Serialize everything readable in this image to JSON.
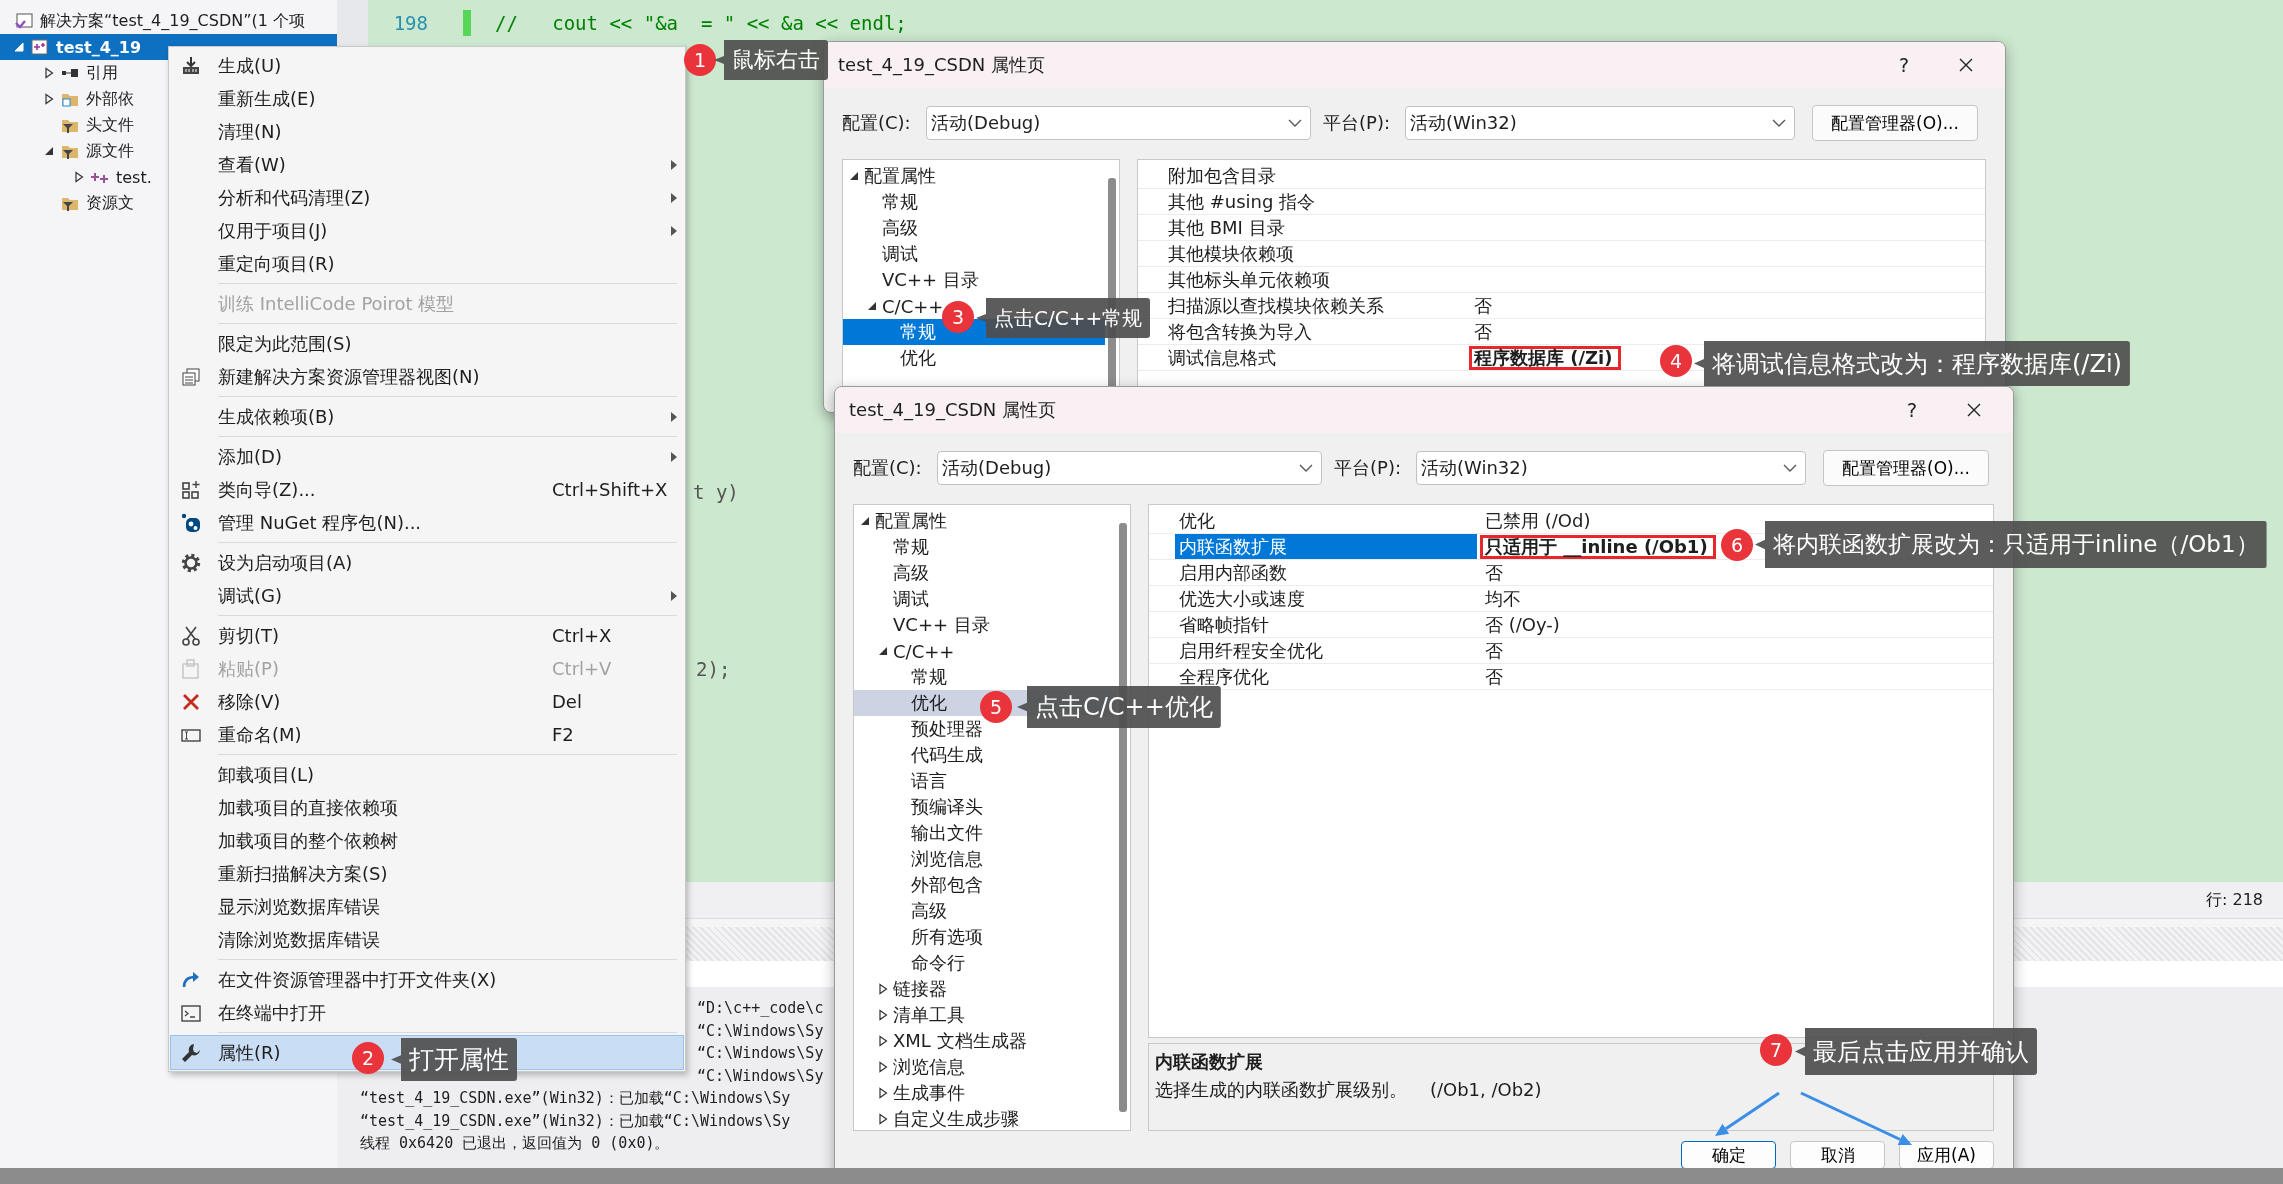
{
  "solution_explorer": {
    "title": "解决方案“test_4_19_CSDN”(1 个项",
    "tree": [
      {
        "label": "test_4_19",
        "kind": "project",
        "expanded": true,
        "selected": true,
        "children": [
          {
            "label": "引用",
            "kind": "references",
            "expanded": false,
            "selected": false
          },
          {
            "label": "外部依",
            "kind": "external",
            "expanded": false,
            "selected": false
          },
          {
            "label": "头文件",
            "kind": "filter",
            "selected": false
          },
          {
            "label": "源文件",
            "kind": "filter",
            "expanded": true,
            "selected": false,
            "children": [
              {
                "label": "test.",
                "kind": "cpp",
                "expanded": false,
                "selected": false
              }
            ]
          },
          {
            "label": "资源文",
            "kind": "filter",
            "selected": false
          }
        ]
      }
    ]
  },
  "editor": {
    "lines": [
      {
        "number": "198",
        "text": "//   cout << \"&a  = \" << &a << endl;"
      }
    ],
    "fragments": [
      "t y)",
      "2);"
    ]
  },
  "context_menu": {
    "groups": [
      [
        {
          "label": "生成(U)",
          "kind": "build",
          "submenu": false,
          "disabled": false,
          "selected": false
        },
        {
          "label": "重新生成(E)",
          "submenu": false,
          "disabled": false,
          "selected": false
        },
        {
          "label": "清理(N)",
          "submenu": false,
          "disabled": false,
          "selected": false
        },
        {
          "label": "查看(W)",
          "submenu": true,
          "disabled": false,
          "selected": false
        },
        {
          "label": "分析和代码清理(Z)",
          "submenu": true,
          "disabled": false,
          "selected": false
        },
        {
          "label": "仅用于项目(J)",
          "submenu": true,
          "disabled": false,
          "selected": false
        },
        {
          "label": "重定向项目(R)",
          "submenu": false,
          "disabled": false,
          "selected": false
        }
      ],
      [
        {
          "label": "训练 IntelliCode Poirot 模型",
          "submenu": false,
          "disabled": true,
          "selected": false
        }
      ],
      [
        {
          "label": "限定为此范围(S)",
          "submenu": false,
          "disabled": false,
          "selected": false
        },
        {
          "label": "新建解决方案资源管理器视图(N)",
          "kind": "newview",
          "submenu": false,
          "disabled": false,
          "selected": false
        }
      ],
      [
        {
          "label": "生成依赖项(B)",
          "submenu": true,
          "disabled": false,
          "selected": false
        }
      ],
      [
        {
          "label": "添加(D)",
          "submenu": true,
          "disabled": false,
          "selected": false
        },
        {
          "label": "类向导(Z)...",
          "kind": "wizard",
          "shortcut": "Ctrl+Shift+X",
          "submenu": false,
          "disabled": false,
          "selected": false
        },
        {
          "label": "管理 NuGet 程序包(N)...",
          "kind": "package",
          "submenu": false,
          "disabled": false,
          "selected": false
        }
      ],
      [
        {
          "label": "设为启动项目(A)",
          "kind": "gear",
          "submenu": false,
          "disabled": false,
          "selected": false
        },
        {
          "label": "调试(G)",
          "submenu": true,
          "disabled": false,
          "selected": false
        }
      ],
      [
        {
          "label": "剪切(T)",
          "kind": "cut",
          "shortcut": "Ctrl+X",
          "submenu": false,
          "disabled": false,
          "selected": false
        },
        {
          "label": "粘贴(P)",
          "kind": "paste",
          "shortcut": "Ctrl+V",
          "submenu": false,
          "disabled": true,
          "selected": false
        },
        {
          "label": "移除(V)",
          "kind": "remove",
          "shortcut": "Del",
          "submenu": false,
          "disabled": false,
          "selected": false
        },
        {
          "label": "重命名(M)",
          "kind": "rename",
          "shortcut": "F2",
          "submenu": false,
          "disabled": false,
          "selected": false
        }
      ],
      [
        {
          "label": "卸载项目(L)",
          "submenu": false,
          "disabled": false,
          "selected": false
        },
        {
          "label": "加载项目的直接依赖项",
          "submenu": false,
          "disabled": false,
          "selected": false
        },
        {
          "label": "加载项目的整个依赖树",
          "submenu": false,
          "disabled": false,
          "selected": false
        },
        {
          "label": "重新扫描解决方案(S)",
          "submenu": false,
          "disabled": false,
          "selected": false
        },
        {
          "label": "显示浏览数据库错误",
          "submenu": false,
          "disabled": false,
          "selected": false
        },
        {
          "label": "清除浏览数据库错误",
          "submenu": false,
          "disabled": false,
          "selected": false
        }
      ],
      [
        {
          "label": "在文件资源管理器中打开文件夹(X)",
          "kind": "redo",
          "submenu": false,
          "disabled": false,
          "selected": false
        },
        {
          "label": "在终端中打开",
          "kind": "terminal",
          "submenu": false,
          "disabled": false,
          "selected": false
        }
      ],
      [
        {
          "label": "属性(R)",
          "kind": "wrench",
          "submenu": false,
          "disabled": false,
          "selected": true
        }
      ]
    ]
  },
  "status_bar": {
    "line": "行: 218"
  },
  "output": {
    "lines": [
      {
        "kind": "tail",
        "text": "“D:\\c++_code\\c"
      },
      {
        "kind": "tail",
        "text": "“C:\\Windows\\Sy"
      },
      {
        "kind": "tail",
        "text": "“C:\\Windows\\Sy"
      },
      {
        "kind": "tail",
        "text": "“C:\\Windows\\Sy"
      },
      {
        "kind": "full",
        "text": "“test_4_19_CSDN.exe”(Win32)：已加载“C:\\Windows\\Sy"
      },
      {
        "kind": "full",
        "text": "“test_4_19_CSDN.exe”(Win32)：已加载“C:\\Windows\\Sy"
      },
      {
        "kind": "full",
        "text": "线程 0x6420 已退出，返回值为 0 (0x0)。"
      }
    ]
  },
  "dialogs": [
    {
      "title": "test_4_19_CSDN 属性页",
      "help": "?",
      "config_label": "配置(C):",
      "config_value": "活动(Debug)",
      "platform_label": "平台(P):",
      "platform_value": "活动(Win32)",
      "manager_button": "配置管理器(O)...",
      "tree": [
        {
          "label": "配置属性",
          "expanded": true,
          "selected": false,
          "children": [
            {
              "label": "常规",
              "selected": false
            },
            {
              "label": "高级",
              "selected": false
            },
            {
              "label": "调试",
              "selected": false
            },
            {
              "label": "VC++ 目录",
              "selected": false
            },
            {
              "label": "C/C++",
              "expanded": true,
              "selected": false,
              "children": [
                {
                  "label": "常规",
                  "selected": true
                },
                {
                  "label": "优化",
                  "selected": false
                }
              ]
            }
          ]
        }
      ],
      "properties": [
        {
          "name": "附加包含目录",
          "selected": false
        },
        {
          "name": "其他 #using 指令",
          "selected": false
        },
        {
          "name": "其他 BMI 目录",
          "selected": false
        },
        {
          "name": "其他模块依赖项",
          "selected": false
        },
        {
          "name": "其他标头单元依赖项",
          "selected": false
        },
        {
          "name": "扫描源以查找模块依赖关系",
          "value": "否",
          "selected": false,
          "modified": false,
          "highlighted": false
        },
        {
          "name": "将包含转换为导入",
          "value": "否",
          "selected": false,
          "modified": false,
          "highlighted": false
        },
        {
          "name": "调试信息格式",
          "value": "程序数据库 (/Zi)",
          "selected": false,
          "modified": true,
          "highlighted": true
        }
      ]
    },
    {
      "title": "test_4_19_CSDN 属性页",
      "help": "?",
      "config_label": "配置(C):",
      "config_value": "活动(Debug)",
      "platform_label": "平台(P):",
      "platform_value": "活动(Win32)",
      "manager_button": "配置管理器(O)...",
      "tree": [
        {
          "label": "配置属性",
          "expanded": true,
          "selected": false,
          "children": [
            {
              "label": "常规",
              "selected": false
            },
            {
              "label": "高级",
              "selected": false
            },
            {
              "label": "调试",
              "selected": false
            },
            {
              "label": "VC++ 目录",
              "selected": false
            },
            {
              "label": "C/C++",
              "expanded": true,
              "selected": false,
              "children": [
                {
                  "label": "常规",
                  "selected": false
                },
                {
                  "label": "优化",
                  "selected": true
                },
                {
                  "label": "预处理器",
                  "selected": false
                },
                {
                  "label": "代码生成",
                  "selected": false
                },
                {
                  "label": "语言",
                  "selected": false
                },
                {
                  "label": "预编译头",
                  "selected": false
                },
                {
                  "label": "输出文件",
                  "selected": false
                },
                {
                  "label": "浏览信息",
                  "selected": false
                },
                {
                  "label": "外部包含",
                  "selected": false
                },
                {
                  "label": "高级",
                  "selected": false
                },
                {
                  "label": "所有选项",
                  "selected": false
                },
                {
                  "label": "命令行",
                  "selected": false
                }
              ]
            },
            {
              "label": "链接器",
              "expanded": false,
              "selected": false
            },
            {
              "label": "清单工具",
              "expanded": false,
              "selected": false
            },
            {
              "label": "XML 文档生成器",
              "expanded": false,
              "selected": false
            },
            {
              "label": "浏览信息",
              "expanded": false,
              "selected": false
            },
            {
              "label": "生成事件",
              "expanded": false,
              "selected": false
            },
            {
              "label": "自定义生成步骤",
              "expanded": false,
              "selected": false
            }
          ]
        }
      ],
      "properties": [
        {
          "name": "优化",
          "value": "已禁用 (/Od)",
          "selected": false,
          "modified": false,
          "highlighted": false
        },
        {
          "name": "内联函数扩展",
          "value": "只适用于 __inline (/Ob1)",
          "selected": true,
          "modified": true,
          "highlighted": true
        },
        {
          "name": "启用内部函数",
          "value": "否",
          "selected": false,
          "modified": false,
          "highlighted": false
        },
        {
          "name": "优选大小或速度",
          "value": "均不",
          "selected": false,
          "modified": false,
          "highlighted": false
        },
        {
          "name": "省略帧指针",
          "value": "否 (/Oy-)",
          "selected": false,
          "modified": false,
          "highlighted": false
        },
        {
          "name": "启用纤程安全优化",
          "value": "否",
          "selected": false,
          "modified": false,
          "highlighted": false
        },
        {
          "name": "全程序优化",
          "value": "否",
          "selected": false,
          "modified": false,
          "highlighted": false
        }
      ],
      "description": {
        "title": "内联函数扩展",
        "text": "选择生成的内联函数扩展级别。    (/Ob1, /Ob2)"
      },
      "buttons": [
        "确定",
        "取消",
        "应用(A)"
      ]
    }
  ],
  "annotations": [
    {
      "number": "1",
      "text": "鼠标右击"
    },
    {
      "number": "2",
      "text": "打开属性"
    },
    {
      "number": "3",
      "text": "点击C/C++常规"
    },
    {
      "number": "4",
      "text": "将调试信息格式改为：程序数据库(/Zi)"
    },
    {
      "number": "5",
      "text": "点击C/C++优化"
    },
    {
      "number": "6",
      "text": "将内联函数扩展改为：只适用于inline（/Ob1）"
    },
    {
      "number": "7",
      "text": "最后点击应用并确认"
    }
  ]
}
